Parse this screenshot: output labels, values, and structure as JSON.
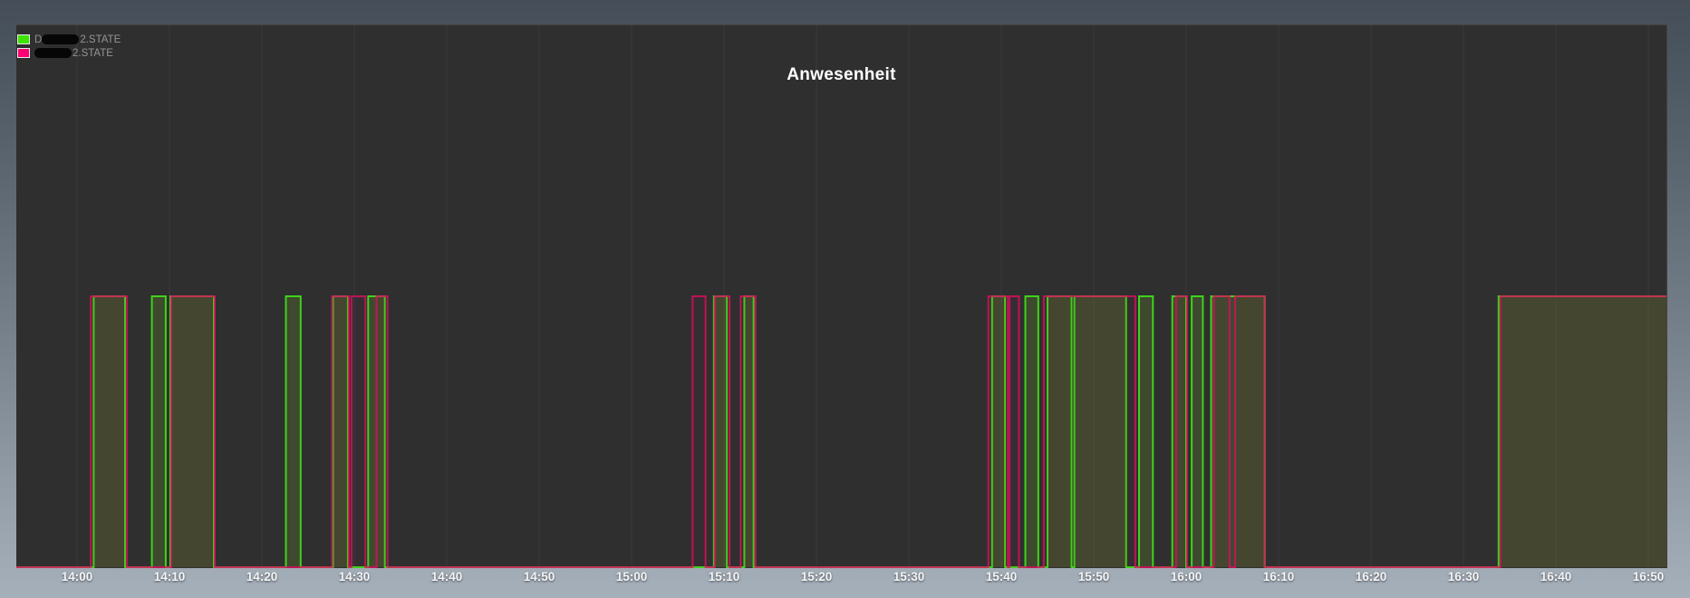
{
  "chart_data": {
    "type": "area",
    "subtype": "binary-step-timeline",
    "title": "Anwesenheit",
    "x_ticks": [
      "14:00",
      "14:10",
      "14:20",
      "14:30",
      "14:40",
      "14:50",
      "15:00",
      "15:10",
      "15:20",
      "15:30",
      "15:40",
      "15:50",
      "16:00",
      "16:10",
      "16:20",
      "16:30",
      "16:40",
      "16:50"
    ],
    "tick_interval_minutes": 10,
    "x_range_minutes": [
      0,
      176
    ],
    "y_levels": [
      0,
      1
    ],
    "grid": "vertical-only",
    "legend_position": "top-left",
    "series": [
      {
        "name": "2.STATE",
        "redacted": true,
        "stroke": "#3ed31b",
        "fill": "rgba(120,170,40,0.22)",
        "intervals_min": [
          [
            1.8,
            5.2
          ],
          [
            8.1,
            9.6
          ],
          [
            10.1,
            14.8
          ],
          [
            22.6,
            24.2
          ],
          [
            27.7,
            29.3
          ],
          [
            31.5,
            33.3
          ],
          [
            68.9,
            70.3
          ],
          [
            72.2,
            73.2
          ],
          [
            99.0,
            100.4
          ],
          [
            102.6,
            104.0
          ],
          [
            105.0,
            107.6
          ],
          [
            107.9,
            113.5
          ],
          [
            114.9,
            116.4
          ],
          [
            118.5,
            120.0
          ],
          [
            120.6,
            121.8
          ],
          [
            122.7,
            128.5
          ],
          [
            153.8,
            176
          ]
        ]
      },
      {
        "name": "2.STATE",
        "redacted": true,
        "stroke": "rgba(225,12,95,0.8)",
        "fill": "rgba(225,12,95,0.04)",
        "intervals_min": [
          [
            1.5,
            5.4
          ],
          [
            10.2,
            14.9
          ],
          [
            27.6,
            29.4
          ],
          [
            29.7,
            31.2
          ],
          [
            32.4,
            33.6
          ],
          [
            66.6,
            68.0
          ],
          [
            69.0,
            70.6
          ],
          [
            71.8,
            73.4
          ],
          [
            98.6,
            100.7
          ],
          [
            100.9,
            101.9
          ],
          [
            104.6,
            114.5
          ],
          [
            118.9,
            120.1
          ],
          [
            123.0,
            124.7
          ],
          [
            125.3,
            128.5
          ],
          [
            154.0,
            176
          ]
        ]
      }
    ]
  },
  "legend": {
    "items": [
      {
        "prefix": "D",
        "label": "2.STATE",
        "swatch_color": "#3ce400"
      },
      {
        "prefix": "",
        "label": "2.STATE",
        "swatch_color": "#ff0074"
      }
    ]
  },
  "colors": {
    "plot_background": "#2f2f30",
    "gridline": "#3a3a3b",
    "frame_top": "#454e58",
    "frame_bottom": "#a6b0ba",
    "axis_label": "#f5f5f5",
    "title": "#ffffff",
    "baseline_blend": "#c03451",
    "overlap_edge_blend": "#c0503f"
  }
}
